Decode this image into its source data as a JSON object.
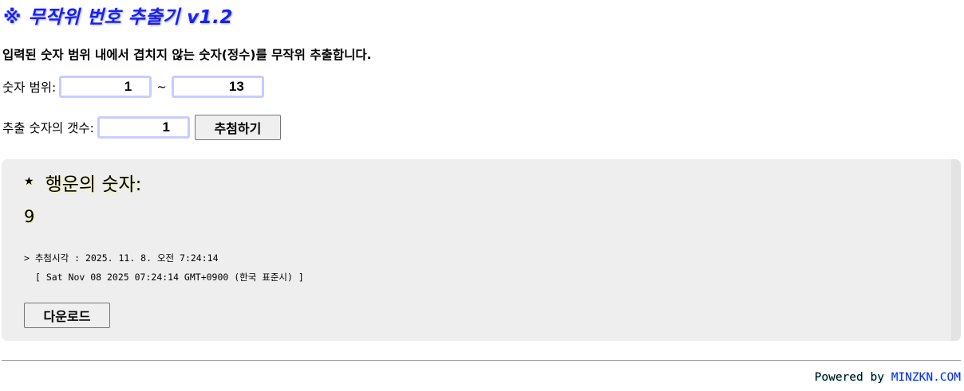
{
  "header": {
    "title": "※ 무작위 번호 추출기 v1.2",
    "description": "입력된 숫자 범위 내에서 겹치지 않는 숫자(정수)를 무작위 추출합니다."
  },
  "form": {
    "range_label": "숫자 범위:",
    "range_min": "1",
    "range_separator": "~",
    "range_max": "13",
    "count_label": "추출 숫자의 갯수:",
    "count": "1",
    "draw_button": "추첨하기"
  },
  "result": {
    "star": "★",
    "heading": "행운의 숫자:",
    "number": "9",
    "time_line": "> 추첨시각 : 2025. 11. 8. 오전 7:24:14",
    "time_raw": "[ Sat Nov 08 2025 07:24:14 GMT+0900 (한국 표준시) ]",
    "download_button": "다운로드"
  },
  "footer": {
    "powered_by": "Powered by",
    "link_text": "MINZKN.COM"
  },
  "colors": {
    "title": "#1a22e6",
    "input_border": "#c9ccff",
    "result_bg": "#eeeeee",
    "link": "#1a22e6"
  }
}
